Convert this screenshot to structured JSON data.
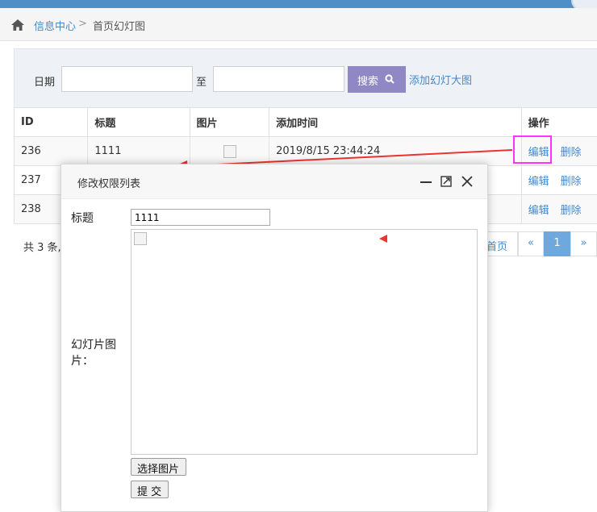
{
  "breadcrumb": {
    "home_icon": "home-icon",
    "parent": "信息中心",
    "separator": ">",
    "current": "首页幻灯图"
  },
  "filter": {
    "date_label": "日期",
    "to_label": "至",
    "date_from": "",
    "date_to": "",
    "search_label": "搜索",
    "search_icon": "search-icon",
    "search_color": "#8f88c5",
    "add_link": "添加幻灯大图"
  },
  "table": {
    "headers": [
      "ID",
      "标题",
      "图片",
      "添加时间",
      "操作"
    ],
    "rows": [
      {
        "id": "236",
        "title": "1111",
        "time": "2019/8/15 23:44:24",
        "edit": "编辑",
        "delete": "删除"
      },
      {
        "id": "237",
        "title": "",
        "time": "",
        "edit": "编辑",
        "delete": "删除"
      },
      {
        "id": "238",
        "title": "",
        "time": "",
        "edit": "编辑",
        "delete": "删除"
      }
    ]
  },
  "pager": {
    "summary": "共 3 条,",
    "first": "首页",
    "prev": "«",
    "current": "1",
    "next": "»",
    "active_color": "#6fa8dc"
  },
  "dialog": {
    "title": "修改权限列表",
    "title_label": "标题",
    "title_value": "1111",
    "image_label": "幻灯片图片：",
    "choose_button": "选择图片",
    "submit_button": "提 交"
  },
  "annotation": {
    "highlight_color": "#ff33ff",
    "arrow_color": "#ee3333"
  }
}
